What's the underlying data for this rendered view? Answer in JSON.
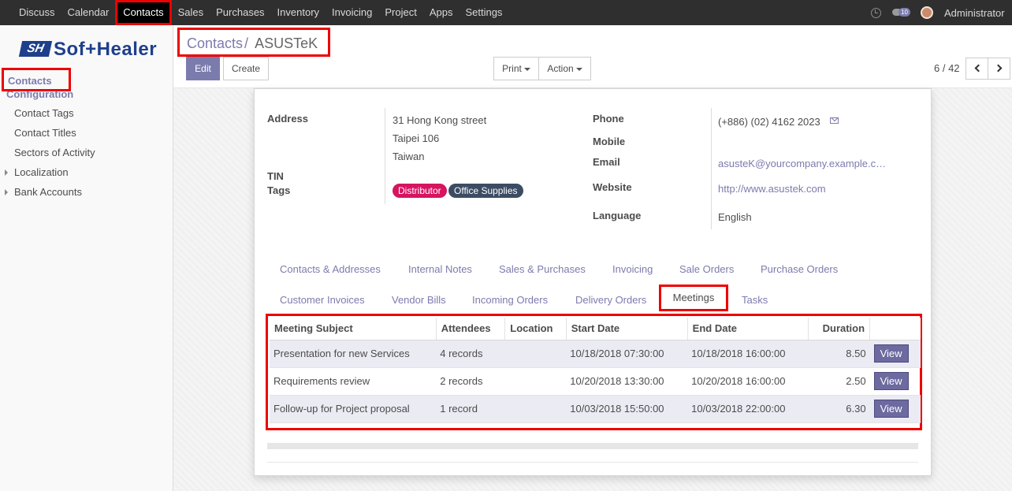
{
  "topbar": {
    "menu": [
      "Discuss",
      "Calendar",
      "Contacts",
      "Sales",
      "Purchases",
      "Inventory",
      "Invoicing",
      "Project",
      "Apps",
      "Settings"
    ],
    "active_menu": "Contacts",
    "messages_badge": "10",
    "user_name": "Administrator"
  },
  "sidebar": {
    "logo_mark": "SH",
    "logo_text": "Sof+Healer",
    "main": "Contacts",
    "section": "Configuration",
    "items": [
      "Contact Tags",
      "Contact Titles",
      "Sectors of Activity"
    ],
    "groups": [
      "Localization",
      "Bank Accounts"
    ]
  },
  "control": {
    "breadcrumb_parent": "Contacts",
    "breadcrumb_sep": "/",
    "breadcrumb_current": "ASUSTeK",
    "edit_label": "Edit",
    "create_label": "Create",
    "print_label": "Print",
    "action_label": "Action",
    "pager": "6 / 42"
  },
  "form": {
    "address_label": "Address",
    "address_lines": [
      "31 Hong Kong street",
      "Taipei 106",
      "Taiwan"
    ],
    "tin_label": "TIN",
    "tags_label": "Tags",
    "tags": [
      {
        "name": "Distributor",
        "color": "#d6145f"
      },
      {
        "name": "Office Supplies",
        "color": "#3c4c63"
      }
    ],
    "phone_label": "Phone",
    "phone": "(+886) (02) 4162 2023",
    "mobile_label": "Mobile",
    "email_label": "Email",
    "email": "asusteK@yourcompany.example.c…",
    "website_label": "Website",
    "website": "http://www.asustek.com",
    "language_label": "Language",
    "language": "English"
  },
  "tabs": {
    "row1": [
      "Contacts & Addresses",
      "Internal Notes",
      "Sales & Purchases",
      "Invoicing",
      "Sale Orders",
      "Purchase Orders"
    ],
    "row2": [
      "Customer Invoices",
      "Vendor Bills",
      "Incoming Orders",
      "Delivery Orders",
      "Meetings",
      "Tasks"
    ],
    "active": "Meetings"
  },
  "meetings": {
    "columns": [
      "Meeting Subject",
      "Attendees",
      "Location",
      "Start Date",
      "End Date",
      "Duration"
    ],
    "view_label": "View",
    "rows": [
      {
        "subject": "Presentation for new Services",
        "attendees": "4 records",
        "location": "",
        "start": "10/18/2018 07:30:00",
        "end": "10/18/2018 16:00:00",
        "duration": "8.50"
      },
      {
        "subject": "Requirements review",
        "attendees": "2 records",
        "location": "",
        "start": "10/20/2018 13:30:00",
        "end": "10/20/2018 16:00:00",
        "duration": "2.50"
      },
      {
        "subject": "Follow-up for Project proposal",
        "attendees": "1 record",
        "location": "",
        "start": "10/03/2018 15:50:00",
        "end": "10/03/2018 22:00:00",
        "duration": "6.30"
      }
    ]
  },
  "colors": {
    "accent": "#7c7bad",
    "highlight_frame": "#ee0000",
    "topbar_bg": "#2f2f2f"
  }
}
